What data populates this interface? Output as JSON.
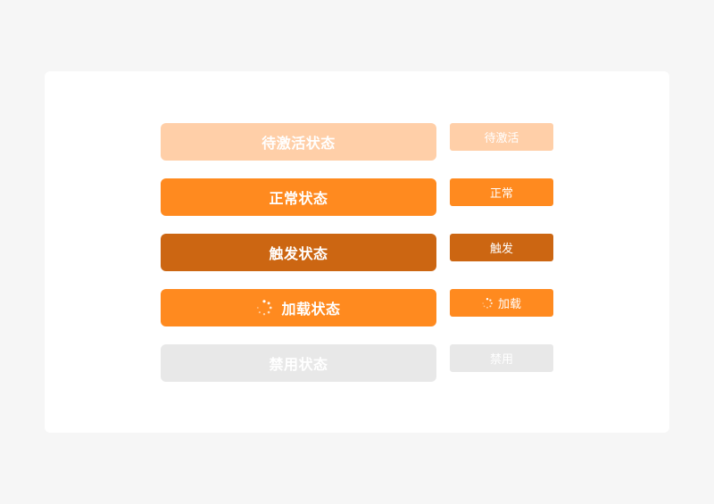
{
  "buttons": {
    "inactive": {
      "large_label": "待激活状态",
      "small_label": "待激活"
    },
    "normal": {
      "large_label": "正常状态",
      "small_label": "正常"
    },
    "pressed": {
      "large_label": "触发状态",
      "small_label": "触发"
    },
    "loading": {
      "large_label": "加载状态",
      "small_label": "加载",
      "icon": "loading-spinner-icon"
    },
    "disabled": {
      "large_label": "禁用状态",
      "small_label": "禁用"
    }
  },
  "colors": {
    "page_background": "#f6f6f6",
    "card_background": "#ffffff",
    "inactive": "#ffcfa8",
    "normal": "#ff8a1f",
    "pressed": "#cc6612",
    "disabled": "#e8e8e8",
    "text": "#ffffff"
  }
}
